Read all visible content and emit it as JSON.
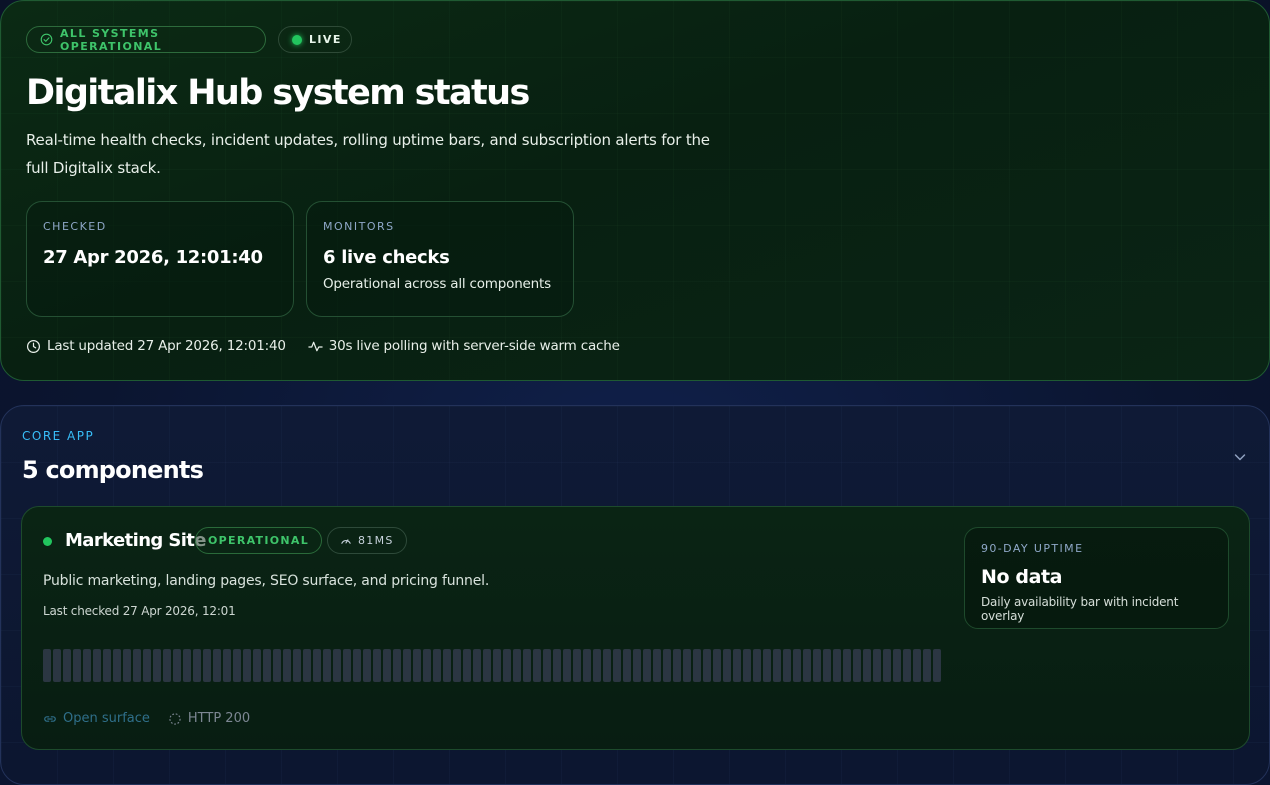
{
  "hero": {
    "status_pill": "ALL SYSTEMS OPERATIONAL",
    "live_pill": "LIVE",
    "title": "Digitalix Hub system status",
    "description": "Real-time health checks, incident updates, rolling uptime bars, and subscription alerts for the full Digitalix stack.",
    "cards": [
      {
        "label": "CHECKED",
        "value": "27 Apr 2026, 12:01:40",
        "sub": ""
      },
      {
        "label": "MONITORS",
        "value": "6 live checks",
        "sub": "Operational across all components"
      }
    ],
    "last_updated": "Last updated 27 Apr 2026, 12:01:40",
    "polling": "30s live polling with server-side warm cache"
  },
  "section": {
    "kicker": "CORE APP",
    "title": "5 components",
    "component": {
      "name": "Marketing Site",
      "status_badge": "OPERATIONAL",
      "latency": "81MS",
      "description": "Public marketing, landing pages, SEO surface, and pricing funnel.",
      "last_checked": "Last checked 27 Apr 2026, 12:01",
      "open_surface": "Open surface",
      "http_status": "HTTP 200",
      "uptime": {
        "label": "90-DAY UPTIME",
        "value": "No data",
        "sub": "Daily availability bar with incident overlay"
      }
    }
  },
  "colors": {
    "operational": "#22c55e",
    "accent_blue": "#38bdf8",
    "bar_no_data": "#2b3642"
  },
  "icons": {
    "status_pill": "check-circle-icon",
    "live": "live-dot-icon",
    "last_updated": "clock-icon",
    "polling": "activity-icon",
    "collapse": "chevron-down-icon",
    "latency": "gauge-icon",
    "open_surface": "link-icon",
    "http": "loader-circle-icon"
  }
}
